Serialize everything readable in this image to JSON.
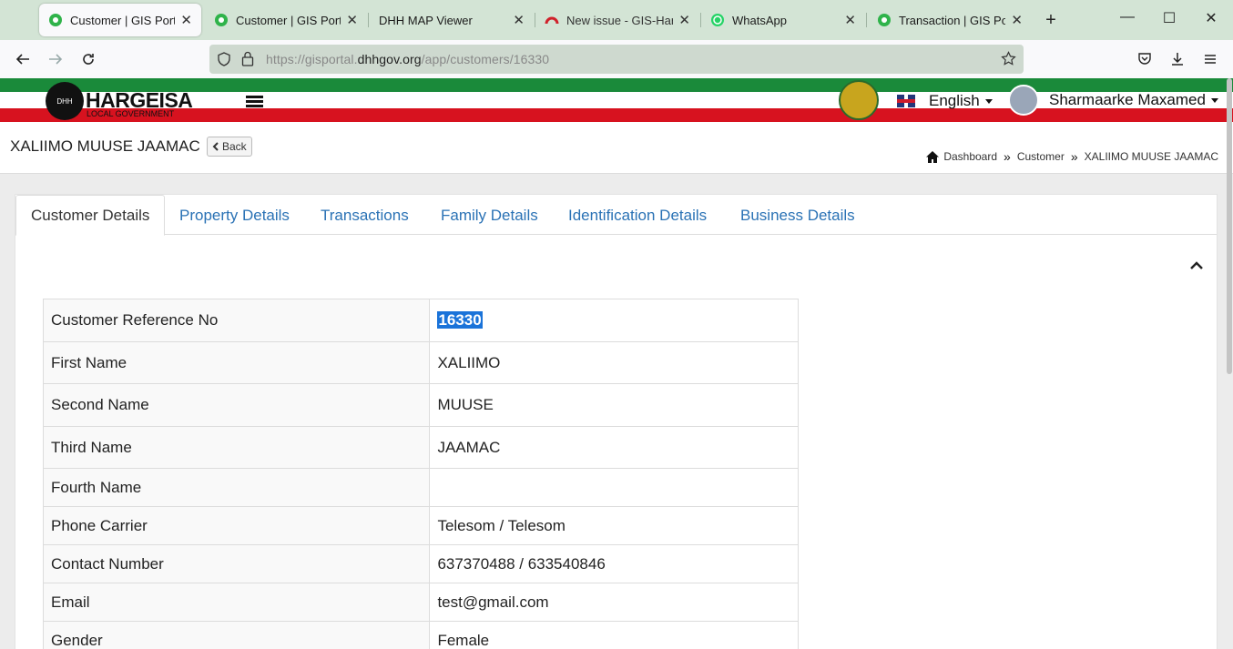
{
  "browser": {
    "tabs": [
      {
        "title": "Customer | GIS Portal",
        "icon": "gis-portal-icon"
      },
      {
        "title": "Customer | GIS Portal",
        "icon": "gis-portal-icon"
      },
      {
        "title": "DHH MAP Viewer",
        "icon": ""
      },
      {
        "title": "New issue - GIS-Hargeisa",
        "icon": "gitlab-icon"
      },
      {
        "title": "WhatsApp",
        "icon": "whatsapp-icon"
      },
      {
        "title": "Transaction | GIS Portal",
        "icon": "gis-portal-icon"
      }
    ],
    "url_prefix": "https://gisportal.",
    "url_domain": "dhhgov.org",
    "url_path": "/app/customers/16330"
  },
  "header": {
    "logo_title": "HARGEISA",
    "logo_subtitle": "LOCAL GOVERNMENT",
    "logo_mark": "DHH",
    "language": "English",
    "user_name": "Sharmaarke Maxamed"
  },
  "title_bar": {
    "page_title": "XALIIMO MUUSE JAAMAC",
    "back_label": "Back",
    "breadcrumb": [
      "Dashboard",
      "Customer",
      "XALIIMO MUUSE JAAMAC"
    ]
  },
  "content_tabs": [
    "Customer Details",
    "Property Details",
    "Transactions",
    "Family Details",
    "Identification Details",
    "Business Details"
  ],
  "customer_details": [
    {
      "label": "Customer Reference No",
      "value": "16330"
    },
    {
      "label": "First Name",
      "value": "XALIIMO"
    },
    {
      "label": "Second Name",
      "value": "MUUSE"
    },
    {
      "label": "Third Name",
      "value": "JAAMAC"
    },
    {
      "label": "Fourth Name",
      "value": ""
    },
    {
      "label": "Phone Carrier",
      "value": "Telesom / Telesom"
    },
    {
      "label": "Contact Number",
      "value": "637370488 / 633540846"
    },
    {
      "label": "Email",
      "value": "test@gmail.com"
    },
    {
      "label": "Gender",
      "value": "Female"
    }
  ],
  "colors": {
    "accent_link": "#2a72b5",
    "flag_green": "#1a8a3a",
    "flag_red": "#d7121f",
    "selection": "#1a73d9"
  }
}
